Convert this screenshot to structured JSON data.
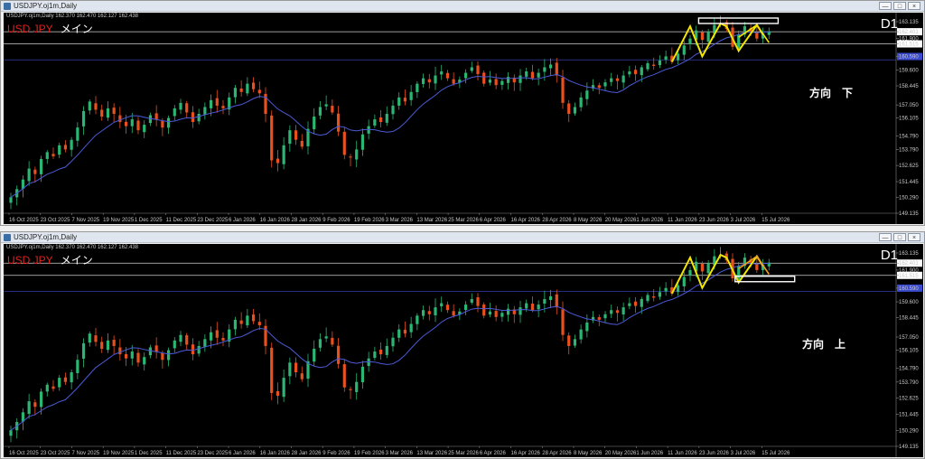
{
  "windows": [
    {
      "title": "USDJPY.oj1m,Daily",
      "symbol_info": "USDJPY.oj1m,Daily  162.370 162.470 162.127 162.438",
      "label_symbol": "USD JPY",
      "label_role": "メイン",
      "timeframe": "D1",
      "direction": "方向　下",
      "zone": "top"
    },
    {
      "title": "USDJPY.oj1m,Daily",
      "symbol_info": "USDJPY.oj1m,Daily  162.370 162.470 162.127 162.438",
      "label_symbol": "USD JPY",
      "label_role": "メイン",
      "timeframe": "D1",
      "direction": "方向　上",
      "zone": "bottom"
    }
  ],
  "controls": {
    "minimize": "—",
    "restore": "□",
    "close": "×"
  },
  "chart_data": {
    "type": "candlestick",
    "x_labels": [
      "16 Oct 2025",
      "23 Oct 2025",
      "7 Nov 2025",
      "19 Nov 2025",
      "1 Dec 2025",
      "11 Dec 2025",
      "23 Dec 2025",
      "6 Jan 2026",
      "16 Jan 2026",
      "28 Jan 2026",
      "9 Feb 2026",
      "19 Feb 2026",
      "3 Mar 2026",
      "13 Mar 2026",
      "25 Mar 2026",
      "6 Apr 2026",
      "16 Apr 2026",
      "28 Apr 2026",
      "8 May 2026",
      "20 May 2026",
      "1 Jun 2026",
      "11 Jun 2026",
      "23 Jun 2026",
      "3 Jul 2026",
      "15 Jul 2026"
    ],
    "y_ticks": [
      "163.135",
      "162.401",
      "161.900",
      "161.515",
      "160.590",
      "159.600",
      "158.445",
      "157.050",
      "156.105",
      "154.790",
      "153.790",
      "152.625",
      "151.445",
      "150.290",
      "149.135"
    ],
    "ylim": [
      149.135,
      163.135
    ],
    "level_lines": [
      162.401,
      161.515,
      160.35
    ],
    "ma_color": "#4a5bd8",
    "bull_color": "#2bb673",
    "bear_color": "#e8501e",
    "closes": [
      150.3,
      150.9,
      151.6,
      152.4,
      152.0,
      153.1,
      153.6,
      153.3,
      154.1,
      153.8,
      154.5,
      155.4,
      156.6,
      157.3,
      156.7,
      156.2,
      156.8,
      156.4,
      155.8,
      155.5,
      156.0,
      155.2,
      155.6,
      156.3,
      156.0,
      155.4,
      156.1,
      156.8,
      157.2,
      156.5,
      155.8,
      156.4,
      156.9,
      157.4,
      157.0,
      156.8,
      157.6,
      158.3,
      158.0,
      158.6,
      158.2,
      157.9,
      156.4,
      153.0,
      152.8,
      154.1,
      155.2,
      154.5,
      154.0,
      155.3,
      156.2,
      156.9,
      157.1,
      156.5,
      155.1,
      153.4,
      153.2,
      153.8,
      154.9,
      155.5,
      156.0,
      155.8,
      156.4,
      157.0,
      157.6,
      157.3,
      158.0,
      158.6,
      159.0,
      158.7,
      159.2,
      159.5,
      159.0,
      158.6,
      158.9,
      159.4,
      159.8,
      159.3,
      158.6,
      158.9,
      158.5,
      158.8,
      159.1,
      158.7,
      159.2,
      159.5,
      159.0,
      159.4,
      159.8,
      160.0,
      159.2,
      157.2,
      156.4,
      156.9,
      157.6,
      158.1,
      158.5,
      158.3,
      158.7,
      159.0,
      158.8,
      159.2,
      159.5,
      159.3,
      159.8,
      160.1,
      159.9,
      160.3,
      160.6,
      160.2,
      160.8,
      161.4,
      161.9,
      162.5,
      161.8,
      162.4,
      162.9,
      163.0,
      162.6,
      161.3,
      162.2,
      162.8,
      162.4,
      161.9,
      162.3,
      162.44
    ]
  }
}
